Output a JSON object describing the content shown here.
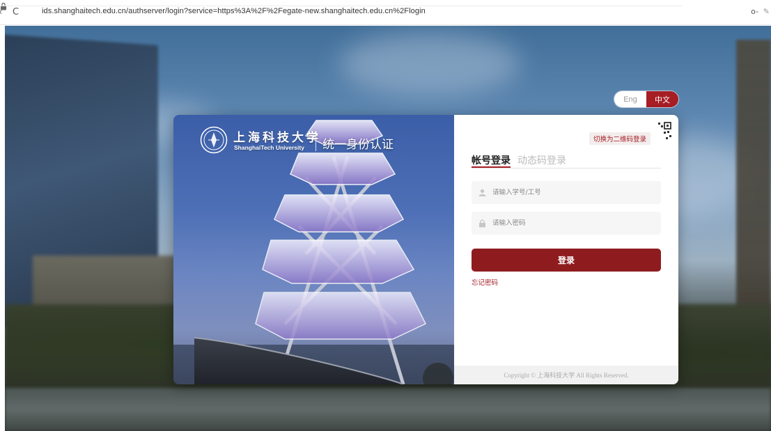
{
  "browser": {
    "url": "ids.shanghaitech.edu.cn/authserver/login?service=https%3A%2F%2Fegate-new.shanghaitech.edu.cn%2Flogin",
    "icons": [
      "back-icon",
      "reload-icon",
      "lock-icon",
      "key-icon",
      "edit-icon"
    ]
  },
  "language": {
    "options": [
      "Eng",
      "中文"
    ],
    "selected": "中文"
  },
  "brand": {
    "name_zh": "上海科技大学",
    "name_en": "ShanghaiTech University",
    "slogan": "统一身份认证"
  },
  "login": {
    "qr_toggle": "切换为二维码登录",
    "tabs": [
      {
        "label": "帐号登录",
        "active": true
      },
      {
        "label": "动态码登录",
        "active": false
      }
    ],
    "username_placeholder": "请输入学号/工号",
    "password_placeholder": "请输入密码",
    "submit": "登录",
    "forgot": "忘记密码"
  },
  "footer": {
    "copyright": "Copyright © 上海科技大学 All Rights Reserved."
  },
  "colors": {
    "accent": "#a61d24",
    "button": "#8e1c1f"
  }
}
